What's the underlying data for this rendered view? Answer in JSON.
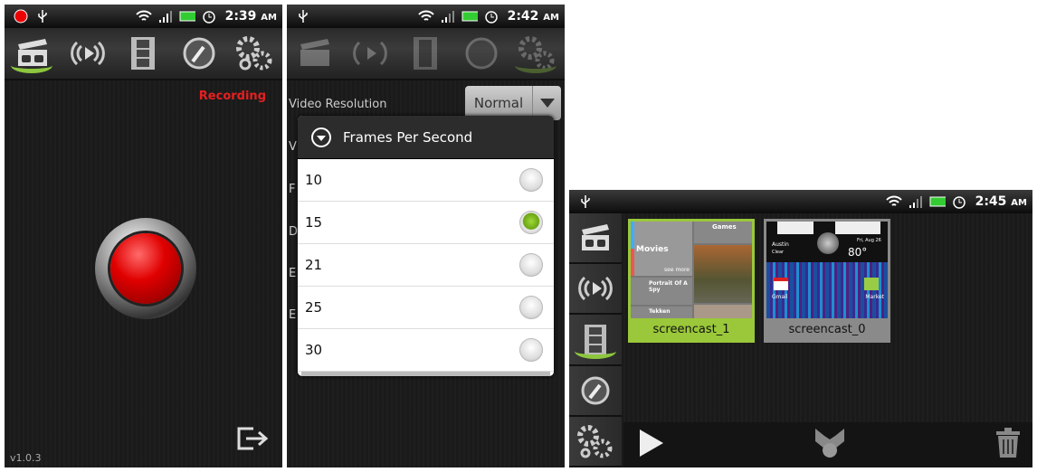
{
  "screens": [
    {
      "status": {
        "time": "2:39",
        "ampm": "AM",
        "icons": [
          "record-dot-icon",
          "usb-icon",
          "wifi-icon",
          "signal-icon",
          "battery-charging-icon",
          "alarm-icon"
        ]
      },
      "tabs": [
        {
          "icon": "clapperboard-icon",
          "active": true
        },
        {
          "icon": "broadcast-icon",
          "active": false
        },
        {
          "icon": "film-strip-icon",
          "active": false
        },
        {
          "icon": "gauge-icon",
          "active": false
        },
        {
          "icon": "gears-icon",
          "active": false
        }
      ],
      "recording_label": "Recording",
      "record_button_color": "#e00000",
      "version": "v1.0.3",
      "exit_icon": "exit-icon"
    },
    {
      "status": {
        "time": "2:42",
        "ampm": "AM"
      },
      "active_tab": "gears-icon",
      "settings": [
        {
          "label": "Video Resolution",
          "value": "Normal"
        },
        {
          "label": "V"
        },
        {
          "label": "F"
        },
        {
          "label": "D"
        },
        {
          "label": "E"
        },
        {
          "label": "E"
        }
      ],
      "dialog": {
        "title": "Frames Per Second",
        "options": [
          "10",
          "15",
          "21",
          "25",
          "30"
        ],
        "selected": "15",
        "accent": "#7cbd1e"
      }
    },
    {
      "status": {
        "time": "2:45",
        "ampm": "AM"
      },
      "active_tab": "film-strip-icon",
      "thumbnails": [
        {
          "caption": "screencast_1",
          "selected": true,
          "preview_text": [
            "Movies",
            "Games",
            "Portrait Of A Spy",
            "Tekken",
            "see more"
          ]
        },
        {
          "caption": "screencast_0",
          "selected": false,
          "preview_text": [
            "Austin",
            "Clear",
            "80°",
            "Fri, Aug 26",
            "Gmail",
            "Market"
          ]
        }
      ],
      "actions": [
        "play-icon",
        "share-icon",
        "trash-icon"
      ],
      "selected_color": "#9ac83a"
    }
  ]
}
